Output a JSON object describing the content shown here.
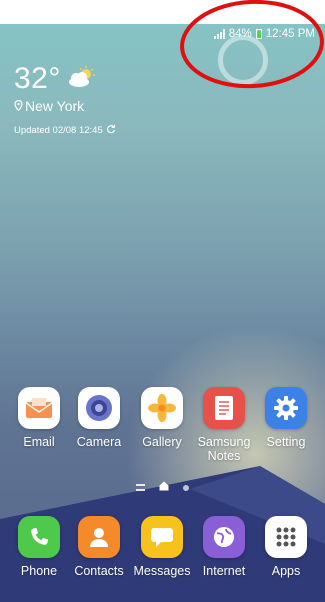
{
  "status_bar": {
    "battery": "84%",
    "time": "12:45 PM"
  },
  "weather": {
    "temperature": "32°",
    "city": "New York",
    "updated": "Updated 02/08 12:45"
  },
  "home_apps": [
    {
      "label": "Email"
    },
    {
      "label": "Camera"
    },
    {
      "label": "Gallery"
    },
    {
      "label": "Samsung Notes"
    },
    {
      "label": "Setting"
    }
  ],
  "dock_apps": [
    {
      "label": "Phone"
    },
    {
      "label": "Contacts"
    },
    {
      "label": "Messages"
    },
    {
      "label": "Internet"
    },
    {
      "label": "Apps"
    }
  ],
  "colors": {
    "annotation": "#e01010",
    "battery_fill": "#4cd94c"
  },
  "icons": {
    "status": [
      "signal-icon",
      "battery-icon"
    ],
    "weather": [
      "partly-cloudy-icon",
      "location-pin-icon",
      "refresh-icon"
    ],
    "home": [
      "email-icon",
      "camera-icon",
      "gallery-icon",
      "notes-icon",
      "settings-gear-icon"
    ],
    "dock": [
      "phone-icon",
      "contacts-icon",
      "messages-icon",
      "internet-icon",
      "apps-grid-icon"
    ]
  }
}
